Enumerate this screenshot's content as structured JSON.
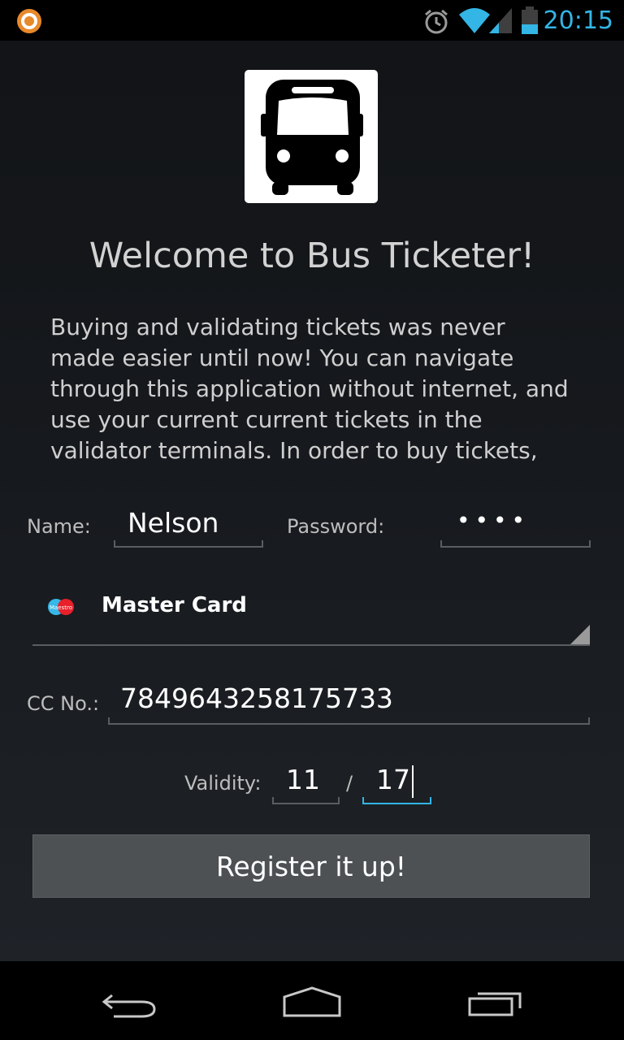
{
  "status_bar": {
    "time": "20:15",
    "accent_color": "#33b5e5",
    "icons": [
      "app-notification-icon",
      "alarm-icon",
      "wifi-icon",
      "signal-icon",
      "battery-icon"
    ]
  },
  "logo": {
    "icon": "bus-icon"
  },
  "welcome": {
    "title": "Welcome to Bus Ticketer!",
    "description": [
      "Buying and validating tickets was never",
      "made easier until now! You can navigate",
      "through this application without internet, and",
      "use your current current tickets in the",
      "validator terminals. In order to buy tickets,"
    ]
  },
  "form": {
    "name_label": "Name:",
    "name_value": "Nelson",
    "password_label": "Password:",
    "password_value": "••••",
    "card_type": {
      "icon": "maestro-card-icon",
      "icon_text": "Maestro",
      "selected": "Master Card"
    },
    "cc_label": "CC No.:",
    "cc_value": "7849643258175733",
    "validity_label": "Validity:",
    "validity_month": "11",
    "validity_separator": "/",
    "validity_year": "17",
    "register_label": "Register it up!"
  },
  "nav_bar": {
    "icons": [
      "back-icon",
      "home-icon",
      "recent-apps-icon"
    ]
  }
}
